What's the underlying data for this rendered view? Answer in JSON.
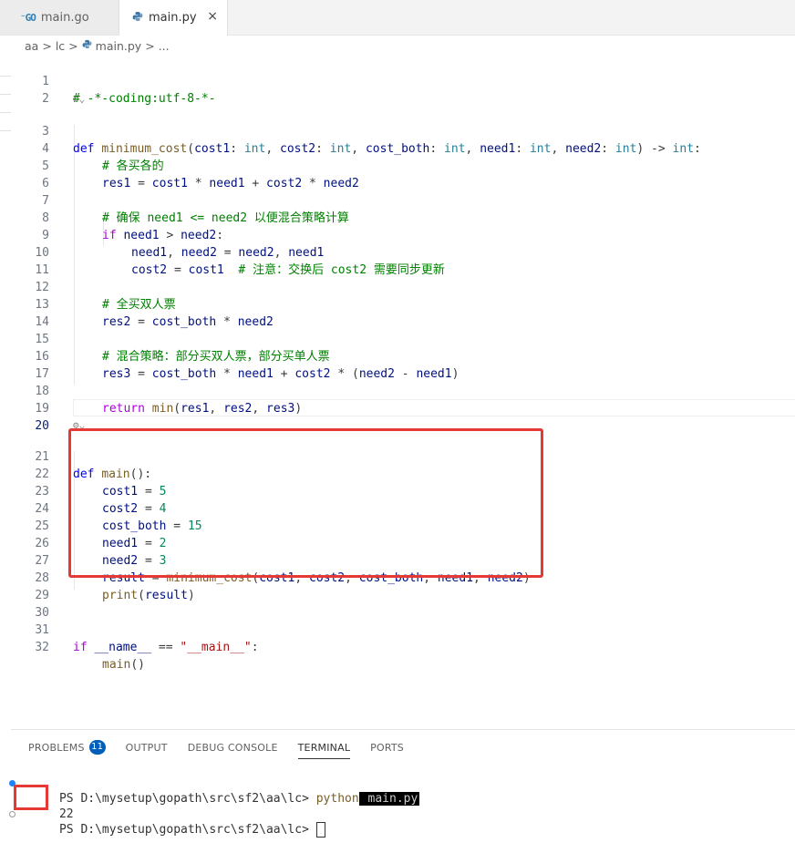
{
  "tabs": [
    {
      "label": "main.go",
      "icon": "go-file-icon"
    },
    {
      "label": "main.py",
      "icon": "python-file-icon",
      "active": true
    }
  ],
  "tab_close": "×",
  "breadcrumb": [
    "aa",
    ">",
    "lc",
    ">",
    "main.py",
    ">",
    "..."
  ],
  "editor": {
    "line_numbers": [
      "1",
      "2",
      "3",
      "4",
      "5",
      "6",
      "7",
      "8",
      "9",
      "10",
      "11",
      "12",
      "13",
      "14",
      "15",
      "16",
      "17",
      "18",
      "19",
      "20",
      "21",
      "22",
      "23",
      "24",
      "25",
      "26",
      "27",
      "28",
      "29",
      "30",
      "31",
      "32"
    ],
    "line_1": "# -*-coding:utf-8-*-",
    "line_4": "# 各买各的",
    "line_7": "# 确保 need1 <= need2 以便混合策略计算",
    "line_10_comment": "# 注意：交换后 cost2 需要同步更新",
    "line_12": "# 全买双人票",
    "line_15": "# 混合策略：部分买双人票，部分买单人票"
  },
  "panel": {
    "tabs": [
      "PROBLEMS",
      "OUTPUT",
      "DEBUG CONSOLE",
      "TERMINAL",
      "PORTS"
    ],
    "problems_count": "11",
    "active_tab": "TERMINAL",
    "prompt": "PS D:\\mysetup\\gopath\\src\\sf2\\aa\\lc> ",
    "command": "python",
    "command_arg": " main.py",
    "output": "22"
  },
  "colors": {
    "highlight": "#e53935",
    "keyword": "#0000ff",
    "comment": "#008000",
    "function": "#795e26"
  }
}
